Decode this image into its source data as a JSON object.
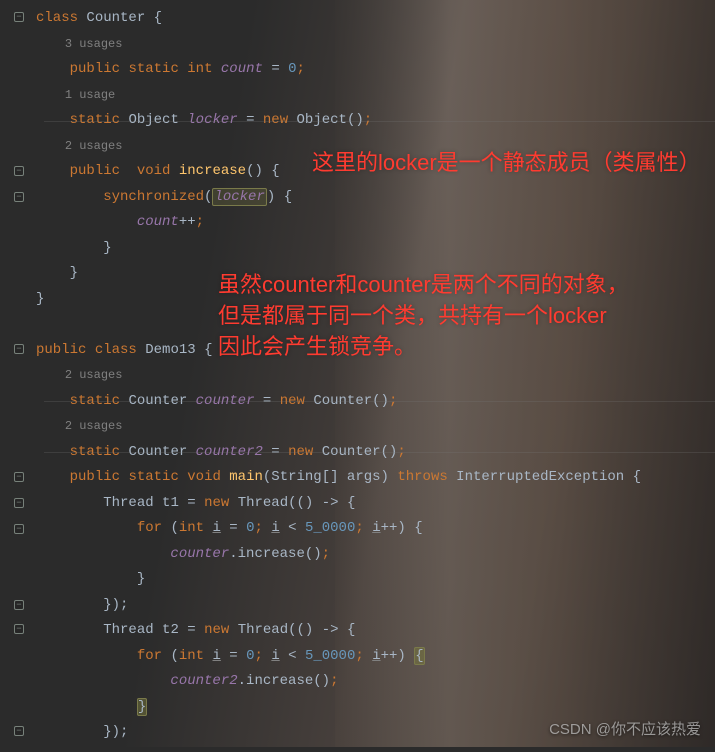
{
  "code": {
    "l1": {
      "kw1": "class",
      "cls": "Counter",
      "brace": "{"
    },
    "usages1": "3 usages",
    "l2": {
      "kw1": "public",
      "kw2": "static",
      "kw3": "int",
      "field": "count",
      "eq": "=",
      "num": "0",
      "semi": ";"
    },
    "usages2": "1 usage",
    "l3": {
      "kw1": "static",
      "type": "Object",
      "field": "locker",
      "eq": "=",
      "kw2": "new",
      "ctor": "Object",
      "paren": "()",
      "semi": ";"
    },
    "usages3": "2 usages",
    "l4": {
      "kw1": "public",
      "kw2": "void",
      "fn": "increase",
      "paren": "()",
      "brace": "{"
    },
    "l5": {
      "kw1": "synchronized",
      "open": "(",
      "arg": "locker",
      "close": ")",
      "brace": "{"
    },
    "l6": {
      "field": "count",
      "op": "++",
      "semi": ";"
    },
    "l7": {
      "close": "}"
    },
    "l8": {
      "close": "}"
    },
    "l9": {
      "close": "}"
    },
    "l10": {
      "kw1": "public",
      "kw2": "class",
      "cls": "Demo13",
      "brace": "{"
    },
    "usages4": "2 usages",
    "l11": {
      "kw1": "static",
      "type": "Counter",
      "field": "counter",
      "eq": "=",
      "kw2": "new",
      "ctor": "Counter",
      "paren": "()",
      "semi": ";"
    },
    "usages5": "2 usages",
    "l12": {
      "kw1": "static",
      "type": "Counter",
      "field": "counter2",
      "eq": "=",
      "kw2": "new",
      "ctor": "Counter",
      "paren": "()",
      "semi": ";"
    },
    "l13": {
      "kw1": "public",
      "kw2": "static",
      "kw3": "void",
      "fn": "main",
      "open": "(",
      "ptype": "String[]",
      "pname": "args",
      "close": ")",
      "kw4": "throws",
      "ex": "InterruptedException",
      "brace": "{"
    },
    "l14": {
      "type": "Thread",
      "var": "t1",
      "eq": "=",
      "kw1": "new",
      "ctor": "Thread",
      "open": "(()",
      "arrow": "->",
      "brace": "{"
    },
    "l15": {
      "kw1": "for",
      "open": "(",
      "kw2": "int",
      "var": "i",
      "eq": "=",
      "num1": "0",
      "semi1": ";",
      "var2": "i",
      "lt": "<",
      "num2": "5_0000",
      "semi2": ";",
      "var3": "i",
      "inc": "++",
      "close": ")",
      "brace": "{"
    },
    "l16": {
      "obj": "counter",
      "dot": ".",
      "call": "increase()",
      "semi": ";"
    },
    "l17": {
      "close": "}"
    },
    "l18": {
      "close": "});"
    },
    "l19": {
      "type": "Thread",
      "var": "t2",
      "eq": "=",
      "kw1": "new",
      "ctor": "Thread",
      "open": "(()",
      "arrow": "->",
      "brace": "{"
    },
    "l20": {
      "kw1": "for",
      "open": "(",
      "kw2": "int",
      "var": "i",
      "eq": "=",
      "num1": "0",
      "semi1": ";",
      "var2": "i",
      "lt": "<",
      "num2": "5_0000",
      "semi2": ";",
      "var3": "i",
      "inc": "++",
      "close": ")",
      "brace": "{"
    },
    "l21": {
      "obj": "counter2",
      "dot": ".",
      "call": "increase()",
      "semi": ";"
    },
    "l22": {
      "close": "}"
    },
    "l23": {
      "close": "});"
    }
  },
  "annotations": {
    "a1": "这里的locker是一个静态成员（类属性）",
    "a2": "虽然counter和counter是两个不同的对象，\n但是都属于同一个类，共持有一个locker\n因此会产生锁竞争。"
  },
  "watermark": "CSDN @你不应该热爱"
}
